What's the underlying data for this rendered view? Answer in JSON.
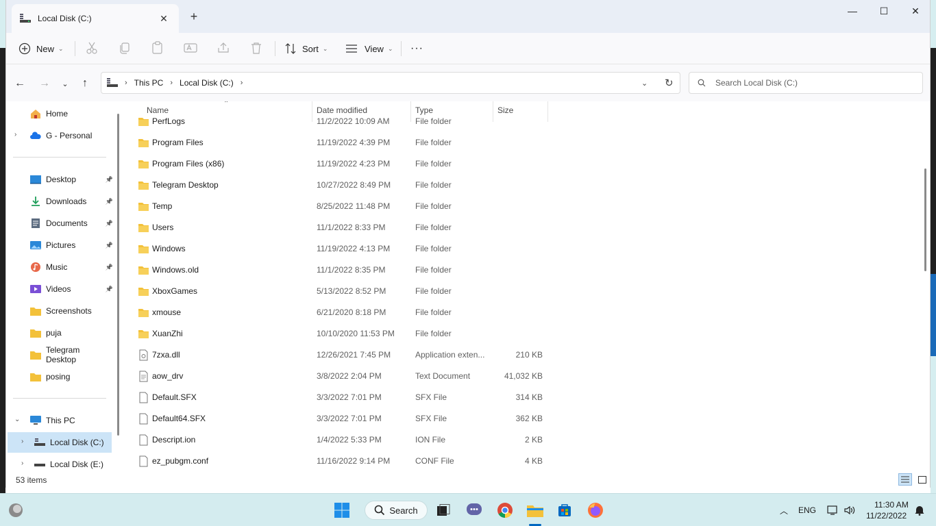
{
  "window": {
    "tab_title": "Local Disk (C:)",
    "new_tab": "+",
    "minimize": "—",
    "maximize": "☐",
    "close": "✕"
  },
  "toolbar": {
    "new_label": "New",
    "sort_label": "Sort",
    "view_label": "View",
    "more": "···"
  },
  "address": {
    "crumbs": [
      "This PC",
      "Local Disk (C:)"
    ],
    "search_placeholder": "Search Local Disk (C:)"
  },
  "nav": {
    "home": "Home",
    "cloud": "G - Personal",
    "quick": [
      {
        "label": "Desktop",
        "pinned": true
      },
      {
        "label": "Downloads",
        "pinned": true
      },
      {
        "label": "Documents",
        "pinned": true
      },
      {
        "label": "Pictures",
        "pinned": true
      },
      {
        "label": "Music",
        "pinned": true
      },
      {
        "label": "Videos",
        "pinned": true
      },
      {
        "label": "Screenshots",
        "pinned": false
      },
      {
        "label": "puja",
        "pinned": false
      },
      {
        "label": "Telegram Desktop",
        "pinned": false
      },
      {
        "label": "posing",
        "pinned": false
      }
    ],
    "this_pc": "This PC",
    "drive_c": "Local Disk (C:)",
    "drive_e": "Local Disk (E:)"
  },
  "columns": {
    "name": "Name",
    "date": "Date modified",
    "type": "Type",
    "size": "Size"
  },
  "files": [
    {
      "name": "PerfLogs",
      "date": "11/2/2022 10:09 AM",
      "type": "File folder",
      "size": "",
      "kind": "folder"
    },
    {
      "name": "Program Files",
      "date": "11/19/2022 4:39 PM",
      "type": "File folder",
      "size": "",
      "kind": "folder"
    },
    {
      "name": "Program Files (x86)",
      "date": "11/19/2022 4:23 PM",
      "type": "File folder",
      "size": "",
      "kind": "folder"
    },
    {
      "name": "Telegram Desktop",
      "date": "10/27/2022 8:49 PM",
      "type": "File folder",
      "size": "",
      "kind": "folder"
    },
    {
      "name": "Temp",
      "date": "8/25/2022 11:48 PM",
      "type": "File folder",
      "size": "",
      "kind": "folder"
    },
    {
      "name": "Users",
      "date": "11/1/2022 8:33 PM",
      "type": "File folder",
      "size": "",
      "kind": "folder"
    },
    {
      "name": "Windows",
      "date": "11/19/2022 4:13 PM",
      "type": "File folder",
      "size": "",
      "kind": "folder"
    },
    {
      "name": "Windows.old",
      "date": "11/1/2022 8:35 PM",
      "type": "File folder",
      "size": "",
      "kind": "folder"
    },
    {
      "name": "XboxGames",
      "date": "5/13/2022 8:52 PM",
      "type": "File folder",
      "size": "",
      "kind": "folder"
    },
    {
      "name": "xmouse",
      "date": "6/21/2020 8:18 PM",
      "type": "File folder",
      "size": "",
      "kind": "folder"
    },
    {
      "name": "XuanZhi",
      "date": "10/10/2020 11:53 PM",
      "type": "File folder",
      "size": "",
      "kind": "folder"
    },
    {
      "name": "7zxa.dll",
      "date": "12/26/2021 7:45 PM",
      "type": "Application exten...",
      "size": "210 KB",
      "kind": "dll"
    },
    {
      "name": "aow_drv",
      "date": "3/8/2022 2:04 PM",
      "type": "Text Document",
      "size": "41,032 KB",
      "kind": "text"
    },
    {
      "name": "Default.SFX",
      "date": "3/3/2022 7:01 PM",
      "type": "SFX File",
      "size": "314 KB",
      "kind": "file"
    },
    {
      "name": "Default64.SFX",
      "date": "3/3/2022 7:01 PM",
      "type": "SFX File",
      "size": "362 KB",
      "kind": "file"
    },
    {
      "name": "Descript.ion",
      "date": "1/4/2022 5:33 PM",
      "type": "ION File",
      "size": "2 KB",
      "kind": "file"
    },
    {
      "name": "ez_pubgm.conf",
      "date": "11/16/2022 9:14 PM",
      "type": "CONF File",
      "size": "4 KB",
      "kind": "file"
    }
  ],
  "status": {
    "count": "53 items"
  },
  "taskbar": {
    "search_label": "Search",
    "lang": "ENG",
    "time": "11:30 AM",
    "date": "11/22/2022"
  },
  "colors": {
    "accent": "#0067c0",
    "selection": "#cce4f7",
    "folder": "#f3c13a",
    "taskbar": "#d4ecef"
  }
}
